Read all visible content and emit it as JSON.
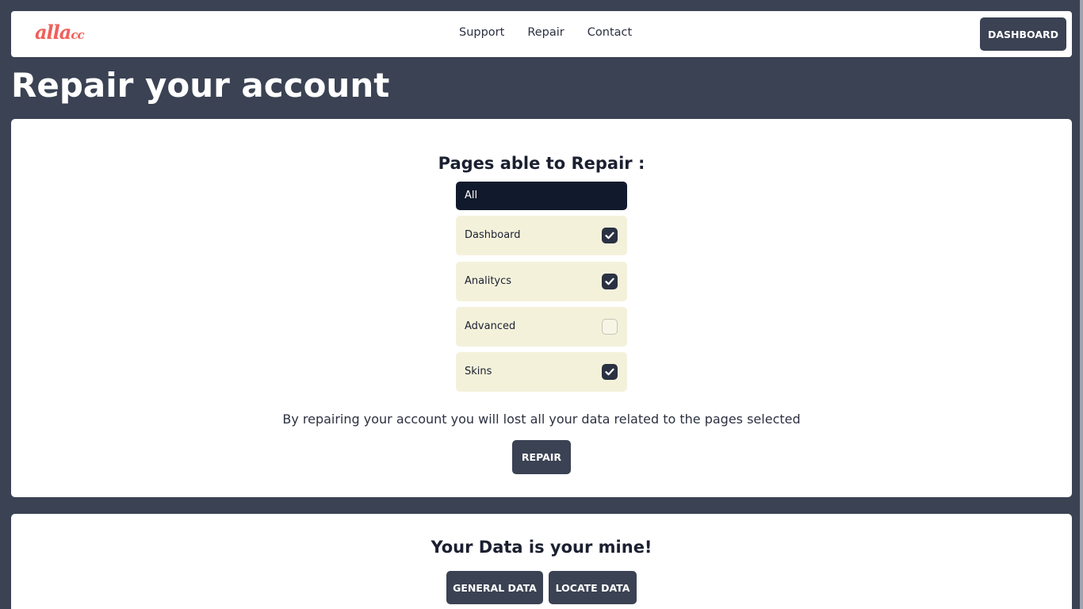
{
  "navbar": {
    "logo_text_large": "alla",
    "logo_text_small": "cc",
    "links": [
      "Support",
      "Repair",
      "Contact"
    ],
    "dashboard_label": "DASHBOARD"
  },
  "page_title": "Repair your account",
  "repair_card": {
    "title": "Pages able to Repair :",
    "select_value": "All",
    "options": [
      {
        "label": "Dashboard",
        "checked": true
      },
      {
        "label": "Analitycs",
        "checked": true
      },
      {
        "label": "Advanced",
        "checked": false
      },
      {
        "label": "Skins",
        "checked": true
      }
    ],
    "warning": "By repairing your account you will lost all your data related to the pages selected",
    "repair_label": "REPAIR"
  },
  "data_card": {
    "title": "Your Data is your mine!",
    "general_label": "GENERAL DATA",
    "locate_label": "LOCATE DATA"
  },
  "colors": {
    "background": "#3a4253",
    "logo": "#f0605a",
    "option_background": "#f4f1db",
    "select_background": "#111a2c"
  },
  "icons": {
    "checked": "check-icon"
  }
}
